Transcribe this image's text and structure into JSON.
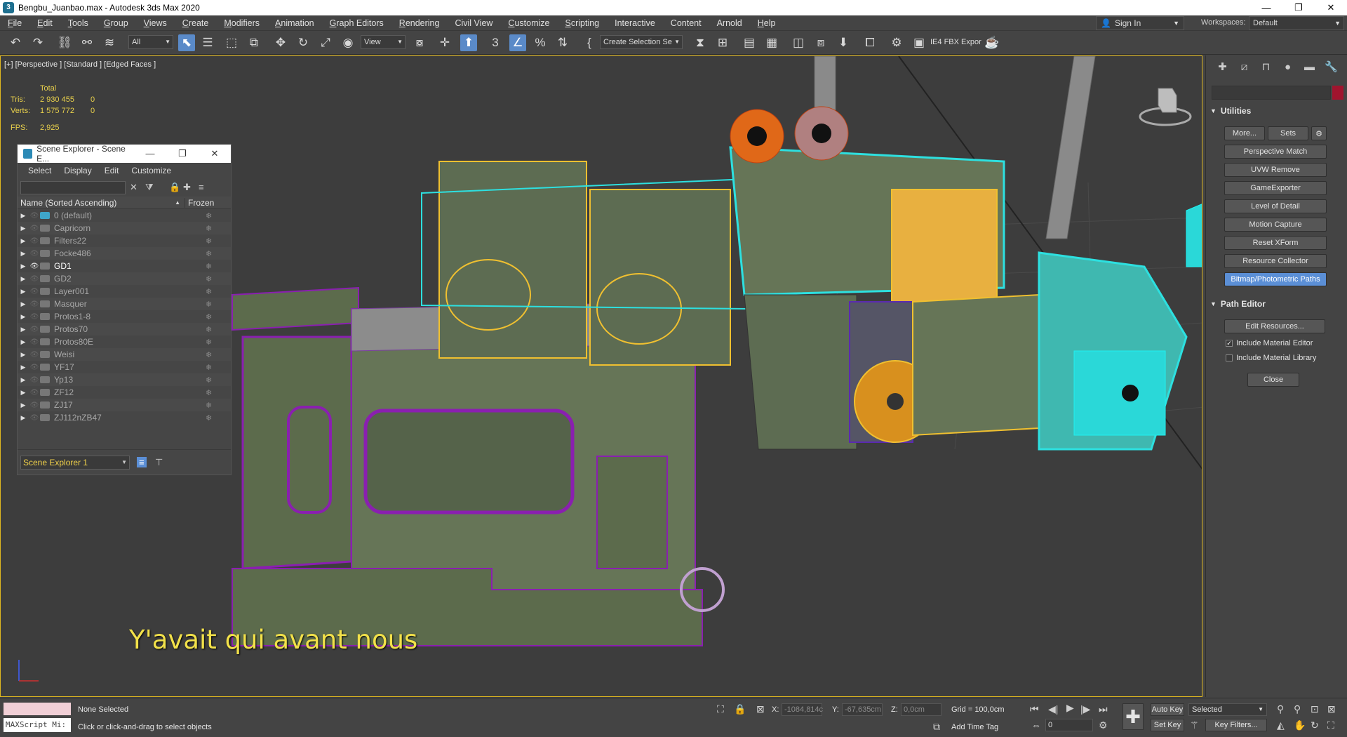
{
  "window": {
    "title": "Bengbu_Juanbao.max - Autodesk 3ds Max 2020",
    "minimize": "—",
    "restore": "❐",
    "close": "✕"
  },
  "menu": [
    {
      "u": "F",
      "rest": "ile"
    },
    {
      "u": "E",
      "rest": "dit"
    },
    {
      "u": "T",
      "rest": "ools"
    },
    {
      "u": "G",
      "rest": "roup"
    },
    {
      "u": "V",
      "rest": "iews"
    },
    {
      "u": "C",
      "rest": "reate"
    },
    {
      "u": "M",
      "rest": "odifiers"
    },
    {
      "u": "A",
      "rest": "nimation"
    },
    {
      "u": "G",
      "rest": "raph Editors"
    },
    {
      "u": "R",
      "rest": "endering"
    },
    {
      "u": "",
      "rest": "Civil View"
    },
    {
      "u": "C",
      "rest": "ustomize"
    },
    {
      "u": "S",
      "rest": "cripting"
    },
    {
      "u": "",
      "rest": "Interactive"
    },
    {
      "u": "",
      "rest": "Content"
    },
    {
      "u": "",
      "rest": "Arnold"
    },
    {
      "u": "H",
      "rest": "elp"
    }
  ],
  "account": {
    "sign_in": "Sign In",
    "workspaces_label": "Workspaces:",
    "workspace": "Default"
  },
  "toolbar": {
    "selection_filter": "All",
    "ref_coord": "View",
    "named_selection": "Create Selection Se",
    "fbx_export": "IE4 FBX Expor"
  },
  "viewport": {
    "label": "[+] [Perspective ] [Standard ] [Edged Faces ]",
    "stats": {
      "header": "Total",
      "tris_label": "Tris:",
      "tris": "2 930 455",
      "tris_sel": "0",
      "verts_label": "Verts:",
      "verts": "1 575 772",
      "verts_sel": "0",
      "fps_label": "FPS:",
      "fps": "2,925"
    },
    "subtitle": "Y'avait qui avant nous"
  },
  "scene_explorer": {
    "title": "Scene Explorer - Scene E...",
    "menu": [
      "Select",
      "Display",
      "Edit",
      "Customize"
    ],
    "col_name": "Name (Sorted Ascending)",
    "col_frozen": "Frozen",
    "layers": [
      {
        "name": "0 (default)",
        "visible": false,
        "active": false,
        "def": true
      },
      {
        "name": "Capricorn",
        "visible": false,
        "active": false,
        "def": false
      },
      {
        "name": "Filters22",
        "visible": false,
        "active": false,
        "def": false
      },
      {
        "name": "Focke486",
        "visible": false,
        "active": false,
        "def": false
      },
      {
        "name": "GD1",
        "visible": true,
        "active": true,
        "def": false
      },
      {
        "name": "GD2",
        "visible": false,
        "active": false,
        "def": false
      },
      {
        "name": "Layer001",
        "visible": false,
        "active": false,
        "def": false
      },
      {
        "name": "Masquer",
        "visible": false,
        "active": false,
        "def": false
      },
      {
        "name": "Protos1-8",
        "visible": false,
        "active": false,
        "def": false
      },
      {
        "name": "Protos70",
        "visible": false,
        "active": false,
        "def": false
      },
      {
        "name": "Protos80E",
        "visible": false,
        "active": false,
        "def": false
      },
      {
        "name": "Weisi",
        "visible": false,
        "active": false,
        "def": false
      },
      {
        "name": "YF17",
        "visible": false,
        "active": false,
        "def": false
      },
      {
        "name": "Yp13",
        "visible": false,
        "active": false,
        "def": false
      },
      {
        "name": "ZF12",
        "visible": false,
        "active": false,
        "def": false
      },
      {
        "name": "ZJ17",
        "visible": false,
        "active": false,
        "def": false
      },
      {
        "name": "ZJ112nZB47",
        "visible": false,
        "active": false,
        "def": false
      }
    ],
    "explorer_name": "Scene Explorer 1"
  },
  "command_panel": {
    "utilities_title": "Utilities",
    "more": "More...",
    "sets": "Sets",
    "utilities": [
      "Perspective Match",
      "UVW Remove",
      "GameExporter",
      "Level of Detail",
      "Motion Capture",
      "Reset XForm",
      "Resource Collector",
      "Bitmap/Photometric Paths"
    ],
    "path_editor_title": "Path Editor",
    "edit_resources": "Edit Resources...",
    "include_material_editor": "Include Material Editor",
    "include_material_library": "Include Material Library",
    "close": "Close"
  },
  "status": {
    "maxscript": "MAXScript Mi:",
    "selection": "None Selected",
    "prompt": "Click or click-and-drag to select objects",
    "x_label": "X:",
    "x": "-1084,814c",
    "y_label": "Y:",
    "y": "-67,635cm",
    "z_label": "Z:",
    "z": "0,0cm",
    "grid": "Grid = 100,0cm",
    "add_time_tag": "Add Time Tag",
    "auto_key": "Auto Key",
    "set_key": "Set Key",
    "key_mode": "Selected",
    "key_filters": "Key Filters...",
    "frame": "0"
  }
}
